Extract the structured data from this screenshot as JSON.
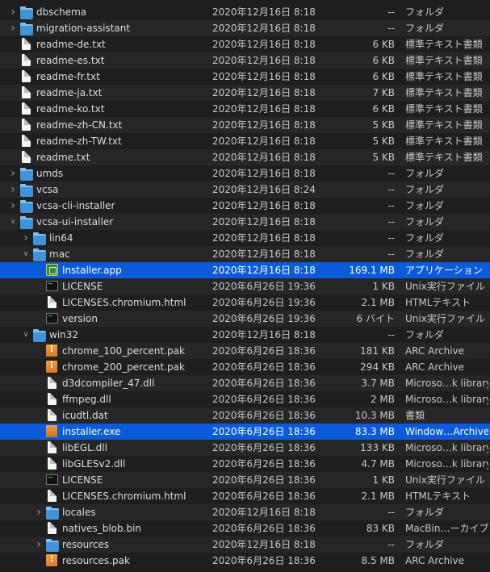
{
  "rows": [
    {
      "name": "dbschema",
      "date": "2020年12月16日 8:18",
      "size": "--",
      "kind": "フォルダ",
      "icon": "folder-icon",
      "disclosure": "collapsed"
    },
    {
      "name": "migration-assistant",
      "date": "2020年12月16日 8:18",
      "size": "--",
      "kind": "フォルダ",
      "icon": "folder-icon",
      "disclosure": "collapsed"
    },
    {
      "name": "readme-de.txt",
      "date": "2020年12月16日 8:18",
      "size": "6 KB",
      "kind": "標準テキスト書類",
      "icon": "document-icon"
    },
    {
      "name": "readme-es.txt",
      "date": "2020年12月16日 8:18",
      "size": "6 KB",
      "kind": "標準テキスト書類",
      "icon": "document-icon"
    },
    {
      "name": "readme-fr.txt",
      "date": "2020年12月16日 8:18",
      "size": "6 KB",
      "kind": "標準テキスト書類",
      "icon": "document-icon"
    },
    {
      "name": "readme-ja.txt",
      "date": "2020年12月16日 8:18",
      "size": "7 KB",
      "kind": "標準テキスト書類",
      "icon": "document-icon"
    },
    {
      "name": "readme-ko.txt",
      "date": "2020年12月16日 8:18",
      "size": "6 KB",
      "kind": "標準テキスト書類",
      "icon": "document-icon"
    },
    {
      "name": "readme-zh-CN.txt",
      "date": "2020年12月16日 8:18",
      "size": "5 KB",
      "kind": "標準テキスト書類",
      "icon": "document-icon"
    },
    {
      "name": "readme-zh-TW.txt",
      "date": "2020年12月16日 8:18",
      "size": "5 KB",
      "kind": "標準テキスト書類",
      "icon": "document-icon"
    },
    {
      "name": "readme.txt",
      "date": "2020年12月16日 8:18",
      "size": "5 KB",
      "kind": "標準テキスト書類",
      "icon": "document-icon"
    },
    {
      "name": "umds",
      "date": "2020年12月16日 8:18",
      "size": "--",
      "kind": "フォルダ",
      "icon": "folder-icon",
      "disclosure": "collapsed"
    },
    {
      "name": "vcsa",
      "date": "2020年12月16日 8:24",
      "size": "--",
      "kind": "フォルダ",
      "icon": "folder-icon",
      "disclosure": "collapsed"
    },
    {
      "name": "vcsa-cli-installer",
      "date": "2020年12月16日 8:18",
      "size": "--",
      "kind": "フォルダ",
      "icon": "folder-icon",
      "disclosure": "collapsed"
    },
    {
      "name": "vcsa-ui-installer",
      "date": "2020年12月16日 8:18",
      "size": "--",
      "kind": "フォルダ",
      "icon": "folder-icon",
      "disclosure": "expanded"
    },
    {
      "name": "lin64",
      "date": "2020年12月16日 8:18",
      "size": "--",
      "kind": "フォルダ",
      "icon": "folder-icon",
      "disclosure": "collapsed",
      "depth": 1
    },
    {
      "name": "mac",
      "date": "2020年12月16日 8:18",
      "size": "--",
      "kind": "フォルダ",
      "icon": "folder-icon",
      "disclosure": "expanded",
      "depth": 1
    },
    {
      "name": "Installer.app",
      "date": "2020年12月16日 8:18",
      "size": "169.1 MB",
      "kind": "アプリケーション",
      "icon": "application-icon",
      "depth": 2,
      "selected": true
    },
    {
      "name": "LICENSE",
      "date": "2020年6月26日 19:36",
      "size": "1 KB",
      "kind": "Unix実行ファイル",
      "icon": "unix-executable-icon",
      "depth": 2
    },
    {
      "name": "LICENSES.chromium.html",
      "date": "2020年6月26日 19:36",
      "size": "2.1 MB",
      "kind": "HTMLテキスト",
      "icon": "document-icon",
      "depth": 2
    },
    {
      "name": "version",
      "date": "2020年6月26日 19:36",
      "size": "6 バイト",
      "kind": "Unix実行ファイル",
      "icon": "unix-executable-icon",
      "depth": 2
    },
    {
      "name": "win32",
      "date": "2020年12月16日 8:18",
      "size": "--",
      "kind": "フォルダ",
      "icon": "folder-icon",
      "disclosure": "expanded",
      "depth": 1
    },
    {
      "name": "chrome_100_percent.pak",
      "date": "2020年6月26日 18:36",
      "size": "181 KB",
      "kind": "ARC Archive",
      "icon": "archive-icon",
      "depth": 2
    },
    {
      "name": "chrome_200_percent.pak",
      "date": "2020年6月26日 18:36",
      "size": "294 KB",
      "kind": "ARC Archive",
      "icon": "archive-icon",
      "depth": 2
    },
    {
      "name": "d3dcompiler_47.dll",
      "date": "2020年6月26日 18:36",
      "size": "3.7 MB",
      "kind": "Microso…k library",
      "icon": "document-icon",
      "depth": 2
    },
    {
      "name": "ffmpeg.dll",
      "date": "2020年6月26日 18:36",
      "size": "2 MB",
      "kind": "Microso…k library",
      "icon": "document-icon",
      "depth": 2
    },
    {
      "name": "icudtl.dat",
      "date": "2020年6月26日 18:36",
      "size": "10.3 MB",
      "kind": "書類",
      "icon": "document-icon",
      "depth": 2
    },
    {
      "name": "installer.exe",
      "date": "2020年6月26日 18:36",
      "size": "83.3 MB",
      "kind": "Window…Archive",
      "icon": "exe-archive-icon",
      "depth": 2,
      "selected": true
    },
    {
      "name": "libEGL.dll",
      "date": "2020年6月26日 18:36",
      "size": "133 KB",
      "kind": "Microso…k library",
      "icon": "document-icon",
      "depth": 2
    },
    {
      "name": "libGLESv2.dll",
      "date": "2020年6月26日 18:36",
      "size": "4.7 MB",
      "kind": "Microso…k library",
      "icon": "document-icon",
      "depth": 2
    },
    {
      "name": "LICENSE",
      "date": "2020年6月26日 18:36",
      "size": "1 KB",
      "kind": "Unix実行ファイル",
      "icon": "unix-executable-icon",
      "depth": 2
    },
    {
      "name": "LICENSES.chromium.html",
      "date": "2020年6月26日 18:36",
      "size": "2.1 MB",
      "kind": "HTMLテキスト",
      "icon": "document-icon",
      "depth": 2
    },
    {
      "name": "locales",
      "date": "2020年12月16日 8:18",
      "size": "--",
      "kind": "フォルダ",
      "icon": "folder-icon",
      "disclosure": "collapsed",
      "depth": 2
    },
    {
      "name": "natives_blob.bin",
      "date": "2020年6月26日 18:36",
      "size": "83 KB",
      "kind": "MacBin…ーカイブ",
      "icon": "document-icon",
      "depth": 2
    },
    {
      "name": "resources",
      "date": "2020年12月16日 8:18",
      "size": "--",
      "kind": "フォルダ",
      "icon": "folder-icon",
      "disclosure": "collapsed",
      "depth": 2
    },
    {
      "name": "resources.pak",
      "date": "2020年6月26日 18:36",
      "size": "8.5 MB",
      "kind": "ARC Archive",
      "icon": "archive-icon",
      "depth": 2
    }
  ]
}
